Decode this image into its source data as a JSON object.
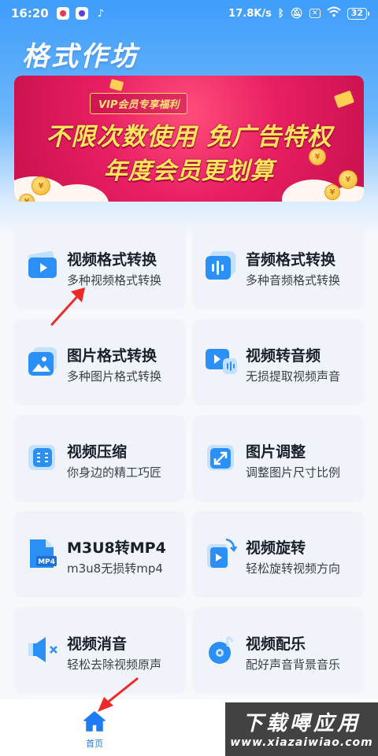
{
  "status_bar": {
    "time": "16:20",
    "network_speed": "17.8K/s",
    "battery": "32"
  },
  "app": {
    "title": "格式作坊"
  },
  "banner": {
    "tag": "VIP会员专享福利",
    "line1": "不限次数使用 免广告特权",
    "line2": "年度会员更划算"
  },
  "tools": [
    {
      "title": "视频格式转换",
      "subtitle": "多种视频格式转换",
      "icon": "video-play-icon"
    },
    {
      "title": "音频格式转换",
      "subtitle": "多种音频格式转换",
      "icon": "audio-wave-icon"
    },
    {
      "title": "图片格式转换",
      "subtitle": "多种图片格式转换",
      "icon": "image-icon"
    },
    {
      "title": "视频转音频",
      "subtitle": "无损提取视频声音",
      "icon": "video-to-audio-icon"
    },
    {
      "title": "视频压缩",
      "subtitle": "你身边的精工巧匠",
      "icon": "compress-icon"
    },
    {
      "title": "图片调整",
      "subtitle": "调整图片尺寸比例",
      "icon": "resize-icon"
    },
    {
      "title": "M3U8转MP4",
      "subtitle": "m3u8无损转mp4",
      "icon": "mp4-file-icon"
    },
    {
      "title": "视频旋转",
      "subtitle": "轻松旋转视频方向",
      "icon": "rotate-video-icon"
    },
    {
      "title": "视频消音",
      "subtitle": "轻松去除视频原声",
      "icon": "mute-icon"
    },
    {
      "title": "视频配乐",
      "subtitle": "配好声音背景音乐",
      "icon": "music-note-icon"
    }
  ],
  "bottom_nav": {
    "home_label": "首页"
  },
  "watermark": {
    "line1": "下载噚应用",
    "line2": "www.xiazaiwiao.com"
  },
  "colors": {
    "accent": "#1d7cf2",
    "banner": "#e81f63",
    "banner_text": "#ffe55c"
  }
}
